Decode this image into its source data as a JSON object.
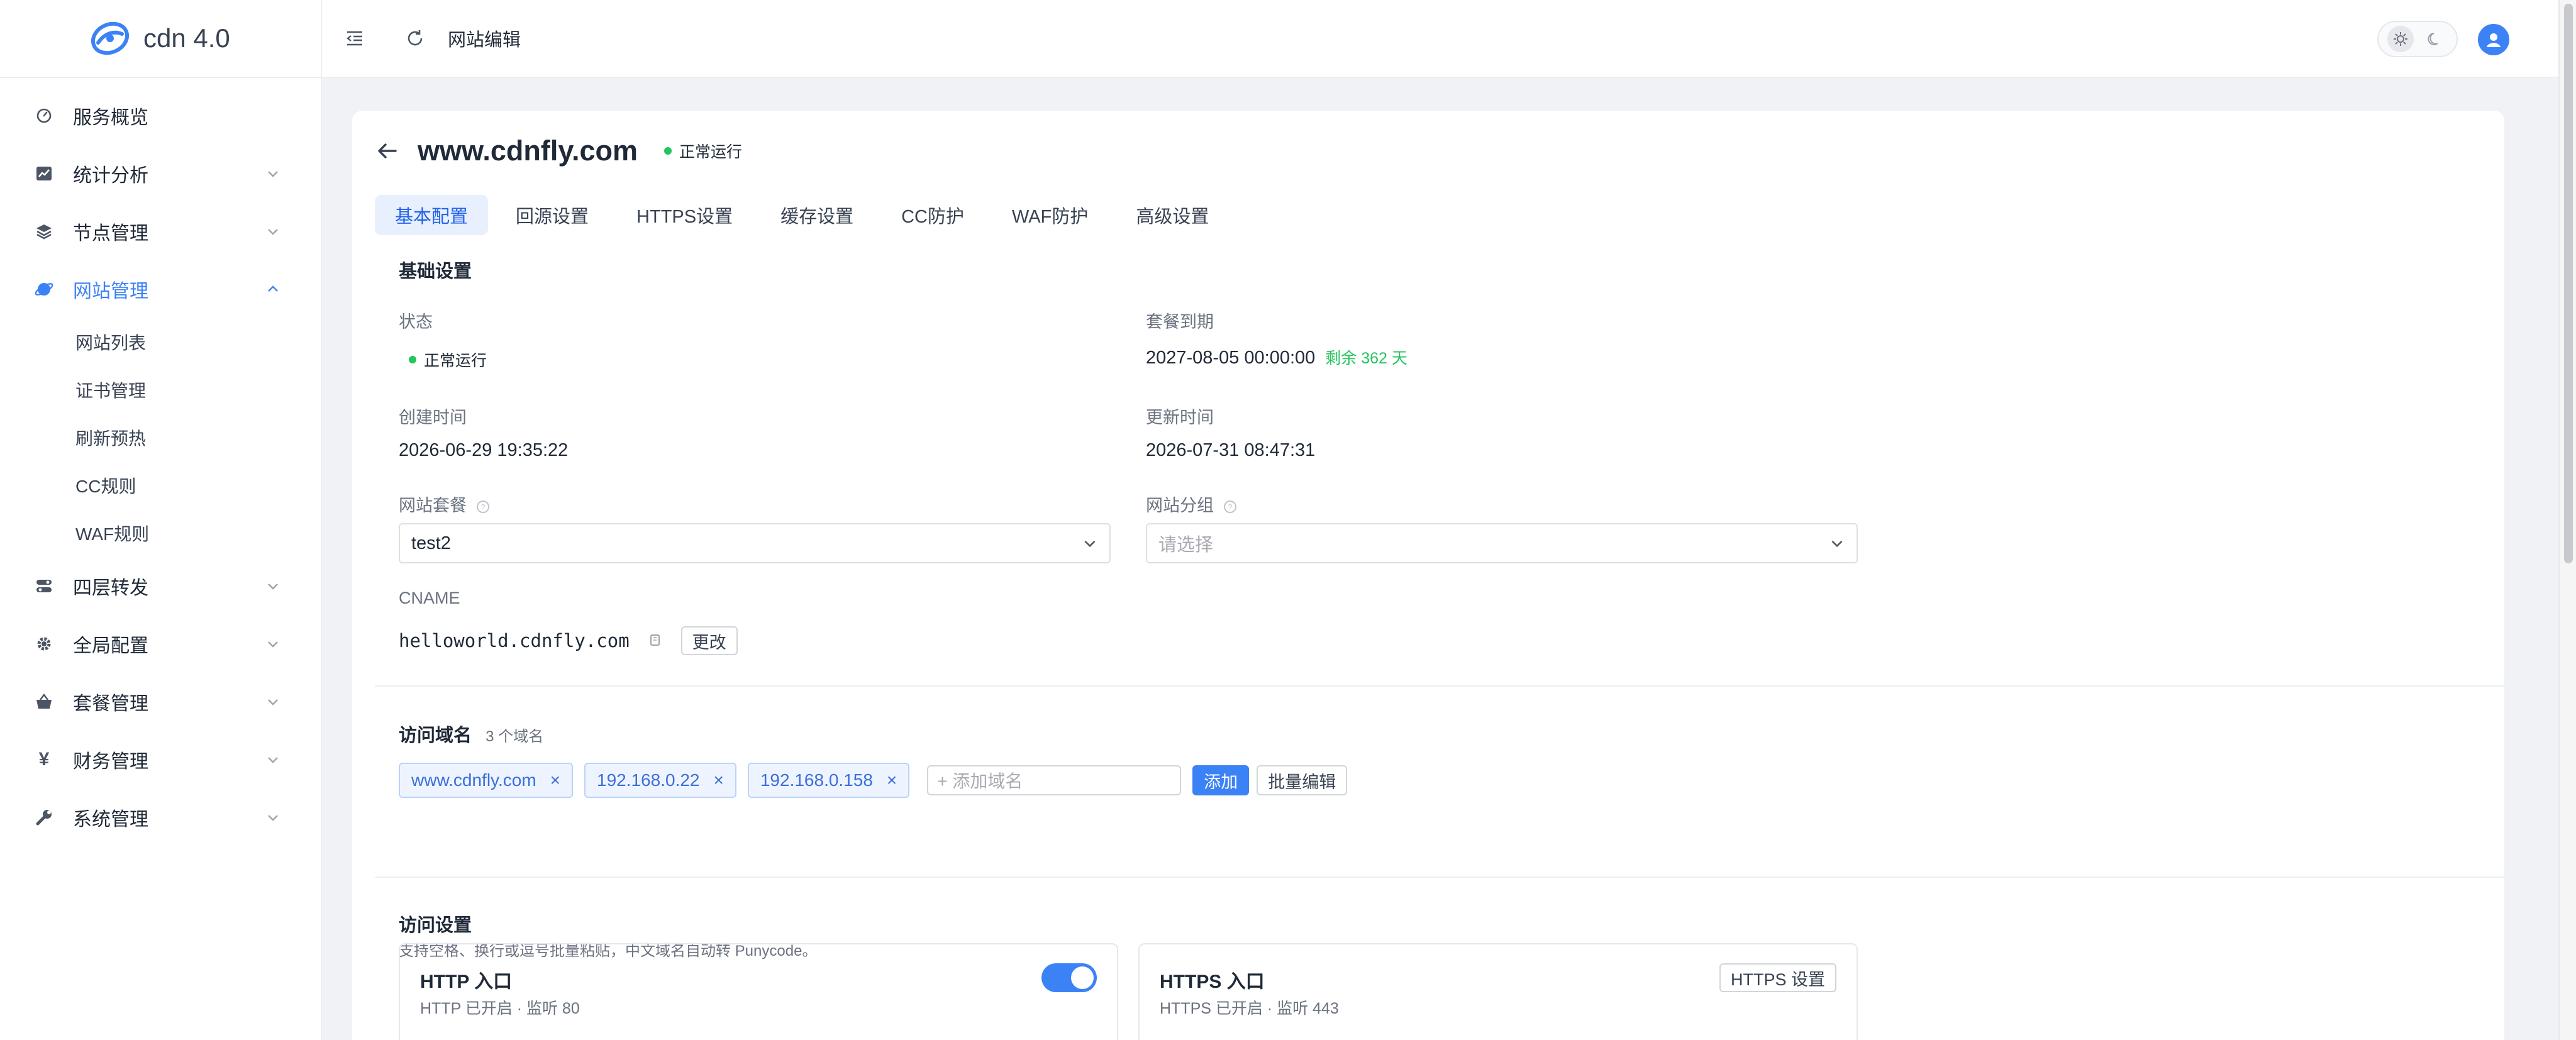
{
  "app": {
    "logo_text": "cdn 4.0"
  },
  "header": {
    "page_title": "网站编辑"
  },
  "sidebar": {
    "items": [
      {
        "label": "服务概览"
      },
      {
        "label": "统计分析"
      },
      {
        "label": "节点管理"
      },
      {
        "label": "网站管理"
      },
      {
        "label": "四层转发"
      },
      {
        "label": "全局配置"
      },
      {
        "label": "套餐管理"
      },
      {
        "label": "财务管理"
      },
      {
        "label": "系统管理"
      }
    ],
    "site_submenu": [
      {
        "label": "网站列表"
      },
      {
        "label": "证书管理"
      },
      {
        "label": "刷新预热"
      },
      {
        "label": "CC规则"
      },
      {
        "label": "WAF规则"
      }
    ]
  },
  "site": {
    "domain": "www.cdnfly.com",
    "status": "正常运行"
  },
  "tabs": [
    {
      "label": "基本配置"
    },
    {
      "label": "回源设置"
    },
    {
      "label": "HTTPS设置"
    },
    {
      "label": "缓存设置"
    },
    {
      "label": "CC防护"
    },
    {
      "label": "WAF防护"
    },
    {
      "label": "高级设置"
    }
  ],
  "basic": {
    "section_title": "基础设置",
    "status_label": "状态",
    "status_value": "正常运行",
    "expire_label": "套餐到期",
    "expire_value": "2027-08-05 00:00:00",
    "expire_remain": "剩余 362 天",
    "created_label": "创建时间",
    "created_value": "2026-06-29 19:35:22",
    "updated_label": "更新时间",
    "updated_value": "2026-07-31 08:47:31",
    "plan_label": "网站套餐",
    "plan_value": "test2",
    "group_label": "网站分组",
    "group_placeholder": "请选择",
    "cname_label": "CNAME",
    "cname_value": "helloworld.cdnfly.com",
    "cname_change": "更改"
  },
  "domains": {
    "section_title": "访问域名",
    "count_text": "3 个域名",
    "tags": [
      "www.cdnfly.com",
      "192.168.0.22",
      "192.168.0.158"
    ],
    "remove_symbol": "×",
    "add_placeholder": "+ 添加域名",
    "add_button": "添加",
    "batch_button": "批量编辑",
    "hint": "支持空格、换行或逗号批量粘贴，中文域名自动转 Punycode。"
  },
  "access": {
    "section_title": "访问设置",
    "http": {
      "title": "HTTP 入口",
      "sub": "HTTP 已开启 · 监听 80",
      "enabled": true
    },
    "https": {
      "title": "HTTPS 入口",
      "sub": "HTTPS 已开启 · 监听 443",
      "button": "HTTPS 设置"
    }
  },
  "colors": {
    "accent": "#3b82f6",
    "success": "#22c55e",
    "tab_active_bg": "#e8f0fd"
  },
  "icons": {
    "logo": "cdn-logo-icon",
    "menu_fold": "menu-fold-icon",
    "refresh": "refresh-icon",
    "sun": "sun-icon",
    "moon": "moon-icon",
    "user": "user-icon",
    "back": "arrow-left-icon",
    "copy": "copy-icon",
    "help": "help-circle-icon",
    "chevron": "chevron-down-icon"
  }
}
